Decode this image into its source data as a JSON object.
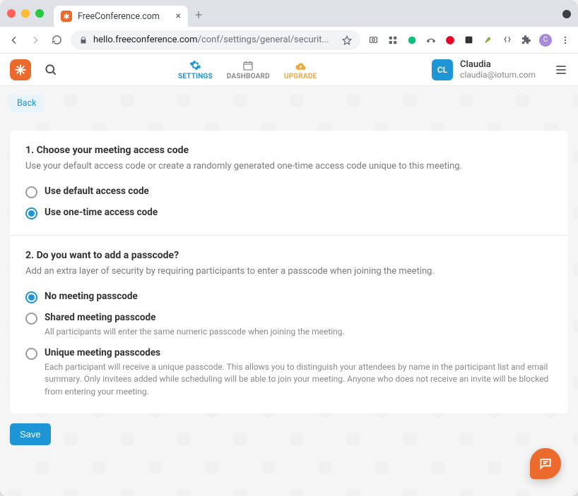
{
  "browser": {
    "tab_title": "FreeConference.com",
    "url_display_prefix": "hello.freeconference.com",
    "url_display_path": "/conf/settings/general/securit..."
  },
  "header": {
    "nav": {
      "settings": "SETTINGS",
      "dashboard": "DASHBOARD",
      "upgrade": "UPGRADE"
    },
    "user": {
      "initials": "CL",
      "name": "Claudia",
      "email": "claudia@iotum.com"
    }
  },
  "page": {
    "back_label": "Back",
    "save_label": "Save",
    "section1": {
      "title": "1. Choose your meeting access code",
      "desc": "Use your default access code or create a randomly generated one-time access code unique to this meeting.",
      "opt_default": "Use default access code",
      "opt_onetime": "Use one-time access code"
    },
    "section2": {
      "title": "2. Do you want to add a passcode?",
      "desc": "Add an extra layer of security by requiring participants to enter a passcode when joining the meeting.",
      "opt_none": "No meeting passcode",
      "opt_shared": "Shared meeting passcode",
      "opt_shared_hint": "All participants will enter the same numeric passcode when joining the meeting.",
      "opt_unique": "Unique meeting passcodes",
      "opt_unique_hint": "Each participant will receive a unique passcode. This allows you to distinguish your attendees by name in the participant list and email summary. Only invitees added while scheduling will be able to join your meeting. Anyone who does not receive an invite will be blocked from entering your meeting."
    }
  }
}
